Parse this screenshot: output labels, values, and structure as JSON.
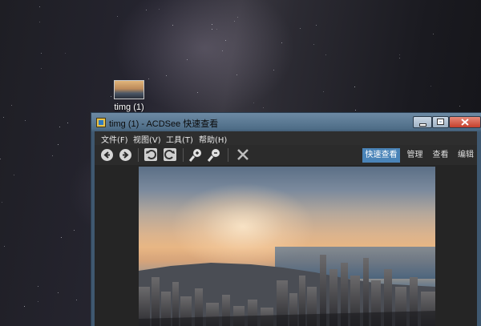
{
  "desktop": {
    "icon_label": "timg (1)"
  },
  "window": {
    "title": "timg (1) - ACDSee 快速查看",
    "menu": [
      {
        "label": "文件(F)"
      },
      {
        "label": "视图(V)"
      },
      {
        "label": "工具(T)"
      },
      {
        "label": "帮助(H)"
      }
    ],
    "toolbar": {
      "back_icon": "arrow-left-icon",
      "forward_icon": "arrow-right-icon",
      "rotate_left_icon": "rotate-left-icon",
      "rotate_right_icon": "rotate-right-icon",
      "zoom_in_icon": "zoom-in-icon",
      "zoom_out_icon": "zoom-out-icon",
      "delete_icon": "close-x-icon"
    },
    "mode_tabs": [
      {
        "label": "快速查看",
        "active": true
      },
      {
        "label": "管理"
      },
      {
        "label": "查看"
      },
      {
        "label": "编辑"
      }
    ]
  },
  "colors": {
    "active_tab": "#4a84b8",
    "toolbar_bg": "#2b2b2b",
    "viewer_bg": "#252525",
    "titlebar": "#5e7d97"
  }
}
